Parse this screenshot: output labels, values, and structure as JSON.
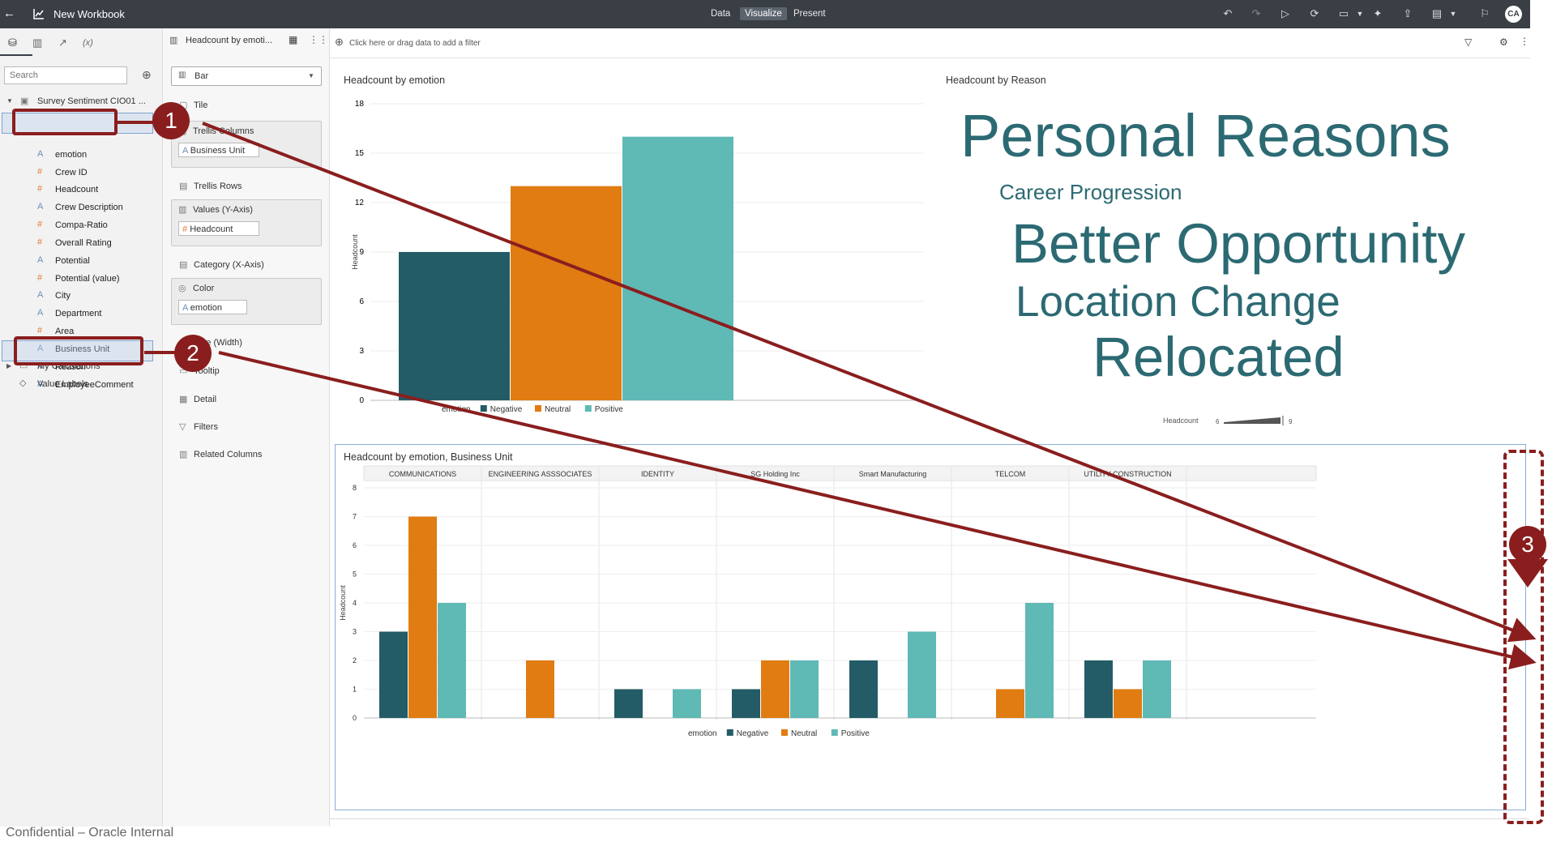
{
  "app": {
    "title": "New Workbook",
    "tabs": [
      "Data",
      "Visualize",
      "Present"
    ],
    "active_tab": "Visualize",
    "avatar": "CA",
    "filter_bar": "Click here or drag data to add a filter"
  },
  "data_panel": {
    "search_placeholder": "Search",
    "dataset": "Survey Sentiment CIO01 ...",
    "fields": [
      {
        "label": "emotion",
        "kind": "attr"
      },
      {
        "label": "Crew ID",
        "kind": "hash"
      },
      {
        "label": "Headcount",
        "kind": "hash"
      },
      {
        "label": "Crew Description",
        "kind": "attr"
      },
      {
        "label": "Compa-Ratio",
        "kind": "hash"
      },
      {
        "label": "Overall Rating",
        "kind": "hash"
      },
      {
        "label": "Potential",
        "kind": "attr"
      },
      {
        "label": "Potential (value)",
        "kind": "hash"
      },
      {
        "label": "City",
        "kind": "attr"
      },
      {
        "label": "Department",
        "kind": "attr"
      },
      {
        "label": "Area",
        "kind": "hash"
      },
      {
        "label": "Business Unit",
        "kind": "attr"
      },
      {
        "label": "Reason",
        "kind": "attr"
      },
      {
        "label": "EmployeeComment",
        "kind": "attr"
      }
    ],
    "my_calculations": "My Calculations",
    "value_labels": "Value Labels"
  },
  "grammar_panel": {
    "viz_name": "Headcount by emoti...",
    "chart_type": "Bar",
    "tile": "Tile",
    "trellis_columns": "Trellis Columns",
    "trellis_columns_value": "Business Unit",
    "trellis_rows": "Trellis Rows",
    "values_y": "Values (Y-Axis)",
    "values_y_value": "Headcount",
    "category_x": "Category (X-Axis)",
    "color": "Color",
    "color_value": "emotion",
    "size": "Size (Width)",
    "tooltip": "Tooltip",
    "detail": "Detail",
    "filters": "Filters",
    "related_columns": "Related Columns"
  },
  "annotations": [
    "1",
    "2",
    "3"
  ],
  "footer": "Confidential – Oracle Internal",
  "colors": {
    "negative": "#235c66",
    "neutral": "#e07c12",
    "positive": "#5fb9b5",
    "annotation": "#8a1e1e"
  },
  "chart1": {
    "title": "Headcount by emotion",
    "ylabel": "Headcount",
    "legend_title": "emotion",
    "legend": [
      "Negative",
      "Neutral",
      "Positive"
    ]
  },
  "chart2": {
    "title": "Headcount by Reason",
    "size_legend_label": "Headcount",
    "size_legend_min": "6",
    "size_legend_max": "9",
    "words": [
      "Personal Reasons",
      "Career Progression",
      "Better Opportunity",
      "Location Change",
      "Relocated"
    ]
  },
  "chart3": {
    "title": "Headcount by emotion, Business Unit",
    "ylabel": "Headcount",
    "legend_title": "emotion",
    "legend": [
      "Negative",
      "Neutral",
      "Positive"
    ]
  },
  "chart_data": [
    {
      "type": "bar",
      "title": "Headcount by emotion",
      "ylabel": "Headcount",
      "categories": [
        "Negative",
        "Neutral",
        "Positive"
      ],
      "values": [
        9,
        13,
        16
      ],
      "ylim": [
        0,
        18
      ],
      "yticks": [
        0,
        3,
        6,
        9,
        12,
        15,
        18
      ],
      "grid": true,
      "legend": "bottom"
    },
    {
      "type": "bar",
      "title": "Headcount by emotion, Business Unit",
      "ylabel": "Headcount",
      "categories": [
        "COMMUNICATIONS",
        "ENGINEERING ASSSOCIATES",
        "IDENTITY",
        "SG Holding Inc",
        "Smart Manufacturing",
        "TELCOM",
        "UTILITY CONSTRUCTION"
      ],
      "series": [
        {
          "name": "Negative",
          "values": [
            3,
            0,
            1,
            1,
            2,
            0,
            2
          ]
        },
        {
          "name": "Neutral",
          "values": [
            7,
            2,
            0,
            2,
            0,
            1,
            1
          ]
        },
        {
          "name": "Positive",
          "values": [
            4,
            0,
            1,
            2,
            3,
            4,
            2
          ]
        }
      ],
      "ylim": [
        0,
        8
      ],
      "yticks": [
        0,
        1,
        2,
        3,
        4,
        5,
        6,
        7,
        8
      ],
      "grid": true,
      "legend": "bottom"
    }
  ]
}
